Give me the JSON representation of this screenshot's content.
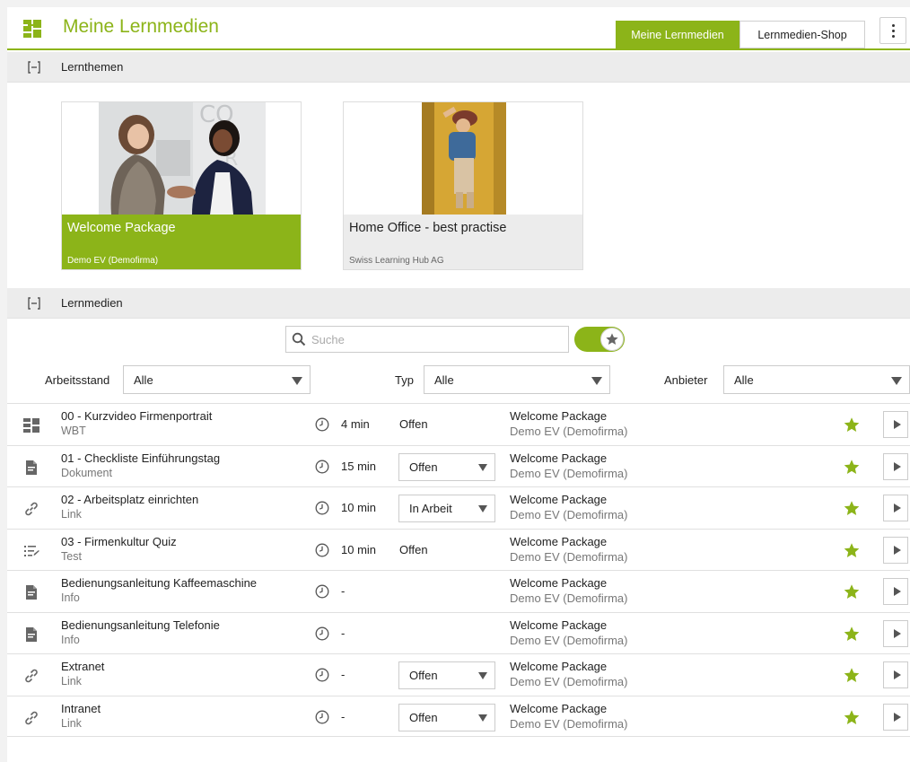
{
  "header": {
    "title": "Meine Lernmedien",
    "tabs": [
      {
        "label": "Meine Lernmedien",
        "active": true
      },
      {
        "label": "Lernmedien-Shop",
        "active": false
      }
    ],
    "accent_color": "#8cb419"
  },
  "topics_section": {
    "label": "Lernthemen",
    "cards": [
      {
        "title": "Welcome Package",
        "provider": "Demo EV (Demofirma)",
        "selected": true
      },
      {
        "title": "Home Office - best practise",
        "provider": "Swiss Learning Hub AG",
        "selected": false
      }
    ]
  },
  "media_section": {
    "label": "Lernmedien",
    "search": {
      "placeholder": "Suche",
      "value": ""
    },
    "favorites_toggle": {
      "on": true
    },
    "filters": {
      "progress": {
        "label": "Arbeitsstand",
        "value": "Alle"
      },
      "type": {
        "label": "Typ",
        "value": "Alle"
      },
      "provider": {
        "label": "Anbieter",
        "value": "Alle"
      }
    },
    "items": [
      {
        "title": "00 - Kurzvideo Firmenportrait",
        "type": "WBT",
        "type_icon": "wbt-icon",
        "duration": "4 min",
        "status": "Offen",
        "status_is_select": false,
        "package": "Welcome Package",
        "provider": "Demo EV (Demofirma)",
        "favorite": true
      },
      {
        "title": "01 - Checkliste Einführungstag",
        "type": "Dokument",
        "type_icon": "document-icon",
        "duration": "15 min",
        "status": "Offen",
        "status_is_select": true,
        "package": "Welcome Package",
        "provider": "Demo EV (Demofirma)",
        "favorite": true
      },
      {
        "title": "02 - Arbeitsplatz einrichten",
        "type": "Link",
        "type_icon": "link-icon",
        "duration": "10 min",
        "status": "In Arbeit",
        "status_is_select": true,
        "package": "Welcome Package",
        "provider": "Demo EV (Demofirma)",
        "favorite": true
      },
      {
        "title": "03 - Firmenkultur Quiz",
        "type": "Test",
        "type_icon": "test-icon",
        "duration": "10 min",
        "status": "Offen",
        "status_is_select": false,
        "package": "Welcome Package",
        "provider": "Demo EV (Demofirma)",
        "favorite": true
      },
      {
        "title": "Bedienungsanleitung Kaffeemaschine",
        "type": "Info",
        "type_icon": "document-icon",
        "duration": "-",
        "status": "",
        "status_is_select": false,
        "package": "Welcome Package",
        "provider": "Demo EV (Demofirma)",
        "favorite": true
      },
      {
        "title": "Bedienungsanleitung Telefonie",
        "type": "Info",
        "type_icon": "document-icon",
        "duration": "-",
        "status": "",
        "status_is_select": false,
        "package": "Welcome Package",
        "provider": "Demo EV (Demofirma)",
        "favorite": true
      },
      {
        "title": "Extranet",
        "type": "Link",
        "type_icon": "link-icon",
        "duration": "-",
        "status": "Offen",
        "status_is_select": true,
        "package": "Welcome Package",
        "provider": "Demo EV (Demofirma)",
        "favorite": true
      },
      {
        "title": "Intranet",
        "type": "Link",
        "type_icon": "link-icon",
        "duration": "-",
        "status": "Offen",
        "status_is_select": true,
        "package": "Welcome Package",
        "provider": "Demo EV (Demofirma)",
        "favorite": true
      }
    ]
  }
}
